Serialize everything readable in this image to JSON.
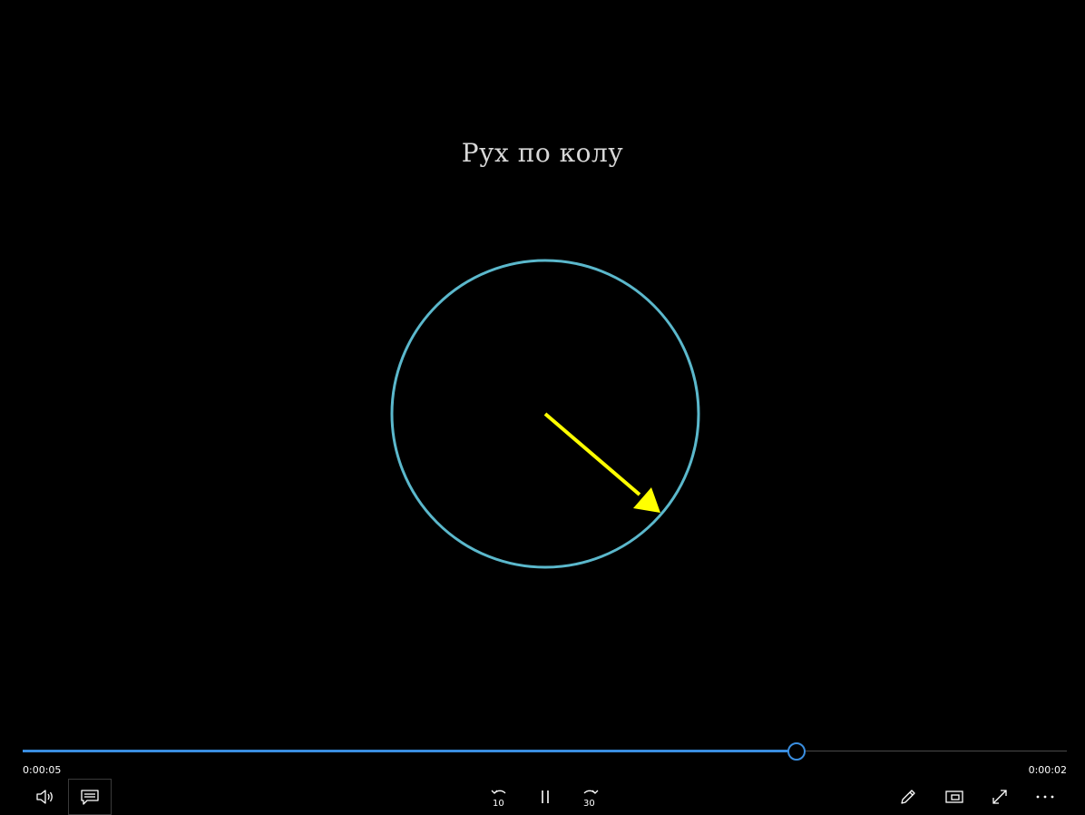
{
  "video": {
    "title": "Рух по колу",
    "circle_color": "#5bb8cc",
    "arrow_color": "#ffff00"
  },
  "playback": {
    "elapsed": "0:00:05",
    "remaining": "0:00:02",
    "progress": 0.74,
    "accent_color": "#3a8ee0"
  },
  "controls": {
    "volume_icon": "speaker-icon",
    "captions_icon": "captions-icon",
    "skip_back_label": "10",
    "play_pause_icon": "pause-icon",
    "skip_forward_label": "30",
    "edit_icon": "pencil-icon",
    "mini_view_icon": "mini-view-icon",
    "fullscreen_icon": "fullscreen-icon",
    "more_icon": "more-icon"
  }
}
